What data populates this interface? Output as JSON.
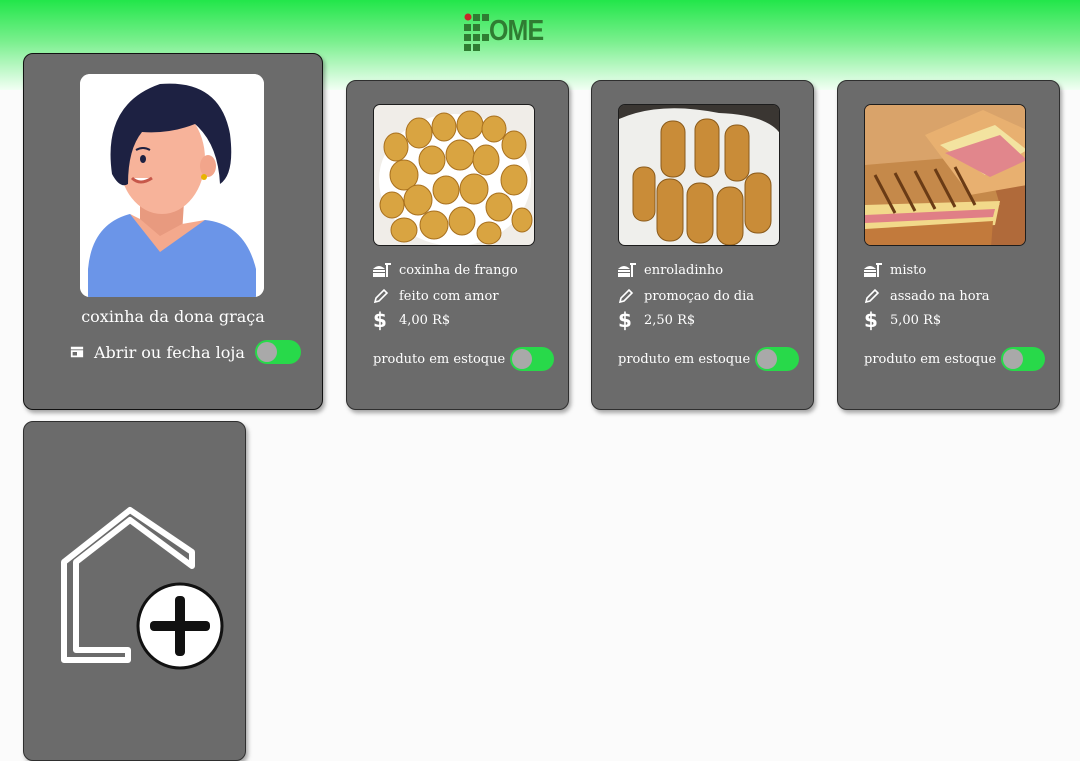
{
  "app": {
    "logo_text": "OME"
  },
  "store": {
    "name": "coxinha da dona graça",
    "toggle_label": "Abrir ou fecha loja",
    "toggle_on": true
  },
  "stock_label": "produto em estoque",
  "products": [
    {
      "name": "coxinha de frango",
      "description": "feito com amor",
      "price": "4,00 R$",
      "in_stock": true
    },
    {
      "name": "enroladinho",
      "description": "promoçao do dia",
      "price": "2,50 R$",
      "in_stock": true
    },
    {
      "name": "misto",
      "description": "assado na hora",
      "price": "5,00 R$",
      "in_stock": true
    }
  ],
  "colors": {
    "accent": "#28d94a",
    "card": "#6b6b6b",
    "header_green": "#22e64a"
  }
}
